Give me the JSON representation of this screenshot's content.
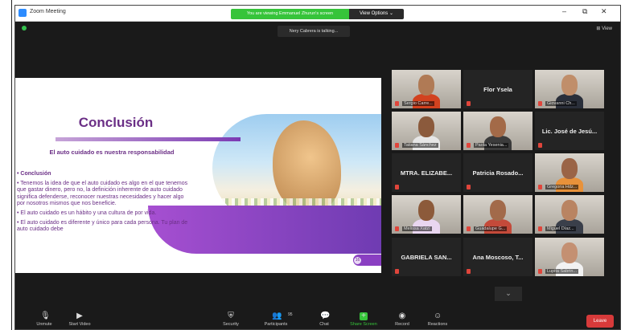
{
  "window": {
    "app_title": "Zoom Meeting",
    "sharing_banner": "You are viewing Emmanuel Zhurun's screen",
    "view_options": "View Options ⌄",
    "controls": [
      "–",
      "⧉",
      "✕"
    ]
  },
  "meeting": {
    "talking_indicator": "Nery Cabrera is talking...",
    "view_label": "⊞ View"
  },
  "slide": {
    "title": "Conclusión",
    "subtitle": "El auto cuidado es nuestra responsabilidad",
    "bullets": [
      "• Conclusión",
      "• Tenemos la idea de que el auto cuidado es algo en el que tenemos que gastar dinero, pero no, la definición inherente de auto cuidado significa defenderse, reconocer nuestras necesidades y hacer algo por nosotros mismos que nos beneficie.",
      "• El auto cuidado es un hábito y una cultura de por vida.",
      "• El auto cuidado es diferente y único para cada persona. Tu plan de auto cuidado debe"
    ],
    "page_number": "16"
  },
  "participants": [
    {
      "name": "Sergio Carre...",
      "type": "video",
      "skin": "#b07a55",
      "shirt": "#d2421f"
    },
    {
      "name": "Flor Ysela",
      "type": "name"
    },
    {
      "name": "Giovanni Ch...",
      "type": "video",
      "skin": "#c08e6a",
      "shirt": "#2a2f3a"
    },
    {
      "name": "Tatiana Sánchez",
      "type": "video",
      "skin": "#8b5a3c",
      "shirt": "#e6e6e6"
    },
    {
      "name": "Paola Yesenia...",
      "type": "video",
      "skin": "#a36a48",
      "shirt": "#3b3b3b"
    },
    {
      "name": "Lic. José de Jesú...",
      "type": "name"
    },
    {
      "name": "MTRA. ELIZABE...",
      "type": "name"
    },
    {
      "name": "Patricia Rosado...",
      "type": "name"
    },
    {
      "name": "Gregoria Hdz...",
      "type": "video",
      "skin": "#9a6446",
      "shirt": "#e8923a"
    },
    {
      "name": "Melissa Xatzí",
      "type": "video",
      "skin": "#8c5a3a",
      "shirt": "#e9d6f0"
    },
    {
      "name": "Guadalupe G...",
      "type": "video",
      "skin": "#a26a4a",
      "shirt": "#c44a3a"
    },
    {
      "name": "Miguel Díaz...",
      "type": "video",
      "skin": "#b98462",
      "shirt": "#3a3f4a"
    },
    {
      "name": "GABRIELA SAN...",
      "type": "name"
    },
    {
      "name": "Ana Moscoso, T...",
      "type": "name"
    },
    {
      "name": "Lupita Sabrin...",
      "type": "video",
      "skin": "#c49072",
      "shirt": "#f2f2f2"
    }
  ],
  "toolbar": {
    "unmute": "Unmute",
    "start_video": "Start Video",
    "security": "Security",
    "participants": "Participants",
    "participants_count": "95",
    "chat": "Chat",
    "share_screen": "Share Screen",
    "record": "Record",
    "reactions": "Reactions",
    "leave": "Leave"
  },
  "colors": {
    "slide_purple": "#6b2f86",
    "share_green": "#36c43a",
    "leave_red": "#d73a3a",
    "muted_red": "#e0453b"
  }
}
